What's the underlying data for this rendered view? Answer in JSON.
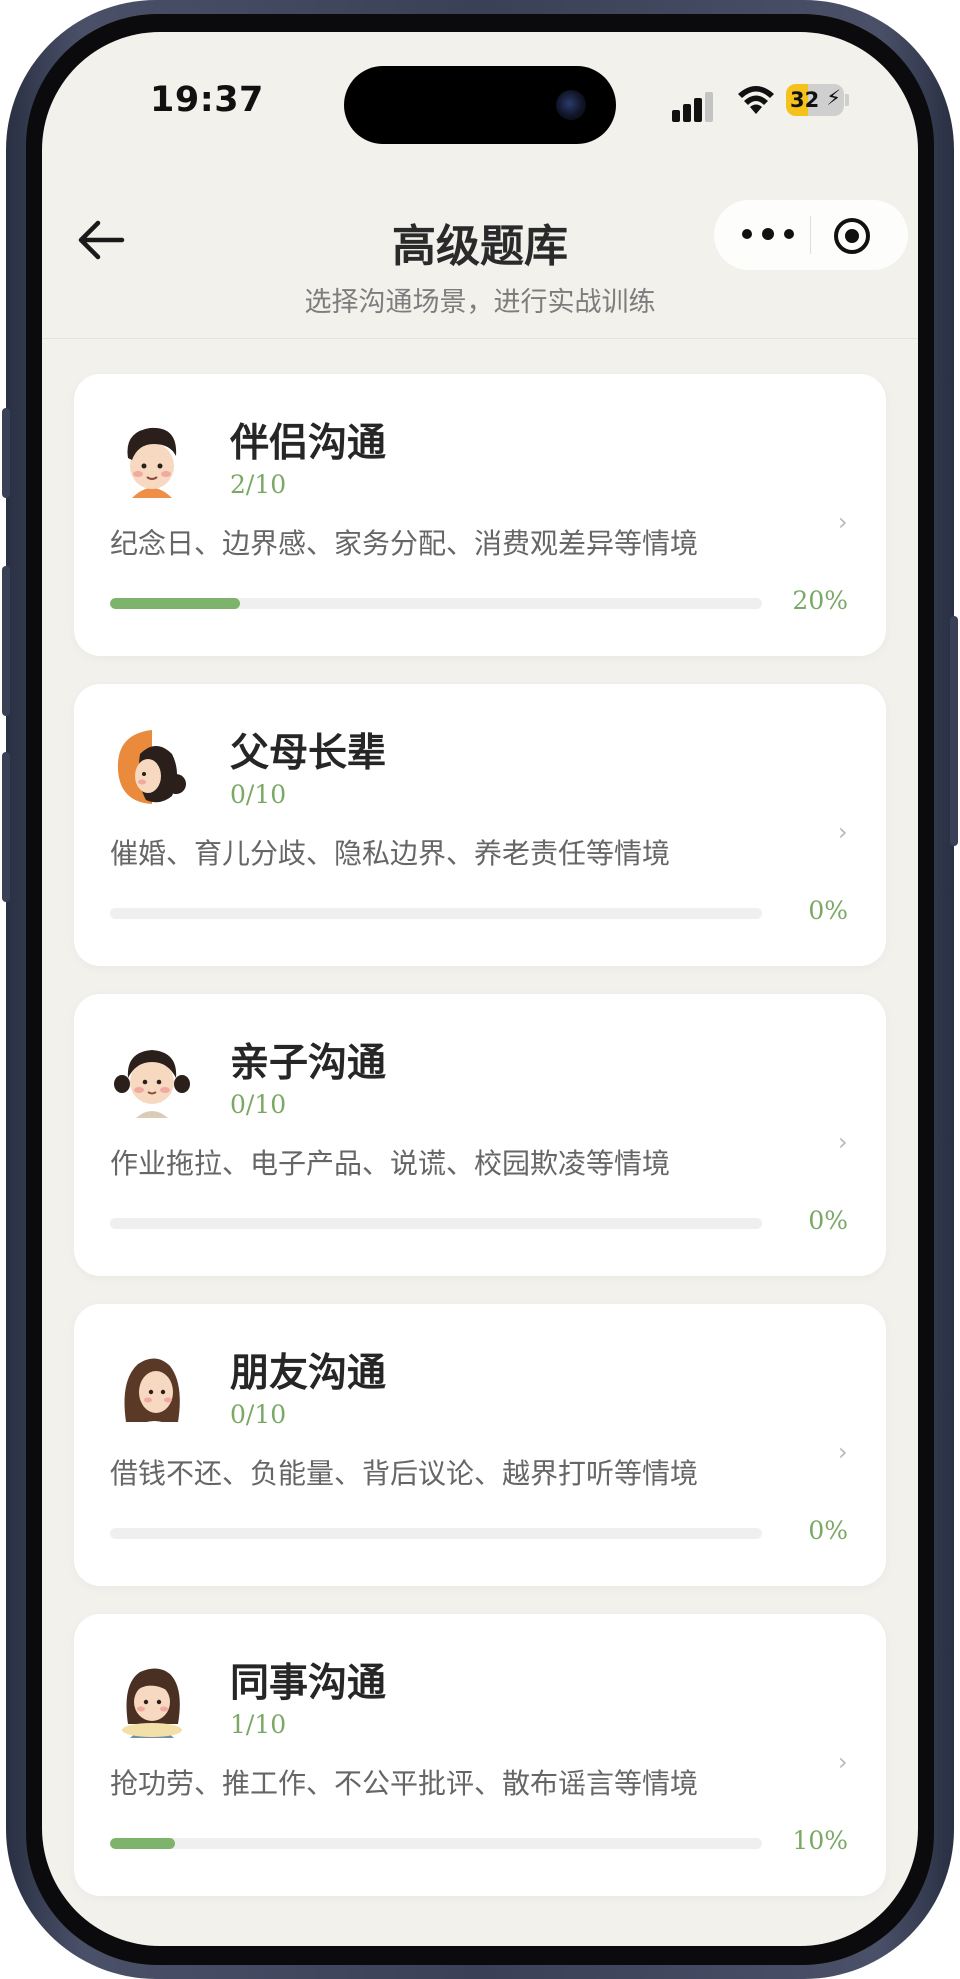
{
  "status_bar": {
    "time": "19:37",
    "battery": "32"
  },
  "header": {
    "title": "高级题库",
    "subtitle": "选择沟通场景，进行实战训练"
  },
  "colors": {
    "accent": "#7db36a",
    "accent_text": "#7aa865",
    "background": "#f2f1ec"
  },
  "categories": [
    {
      "title": "伴侣沟通",
      "count": "2/10",
      "desc": "纪念日、边界感、家务分配、消费观差异等情境",
      "percent": "20%",
      "progress": 0.2,
      "avatar": "boy-avatar-icon"
    },
    {
      "title": "父母长辈",
      "count": "0/10",
      "desc": "催婚、育儿分歧、隐私边界、养老责任等情境",
      "percent": "0%",
      "progress": 0,
      "avatar": "woman-profile-avatar-icon"
    },
    {
      "title": "亲子沟通",
      "count": "0/10",
      "desc": "作业拖拉、电子产品、说谎、校园欺凌等情境",
      "percent": "0%",
      "progress": 0,
      "avatar": "girl-pigtails-avatar-icon"
    },
    {
      "title": "朋友沟通",
      "count": "0/10",
      "desc": "借钱不还、负能量、背后议论、越界打听等情境",
      "percent": "0%",
      "progress": 0,
      "avatar": "girl-long-hair-avatar-icon"
    },
    {
      "title": "同事沟通",
      "count": "1/10",
      "desc": "抢功劳、推工作、不公平批评、散布谣言等情境",
      "percent": "10%",
      "progress": 0.1,
      "avatar": "office-girl-avatar-icon"
    }
  ]
}
